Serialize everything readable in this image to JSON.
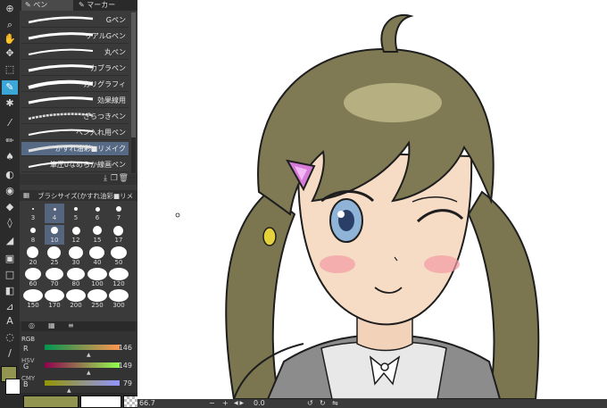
{
  "tabs": {
    "pen": "ペン",
    "marker": "マーカー"
  },
  "brushes": [
    {
      "label": "Gペン"
    },
    {
      "label": "リアルGペン"
    },
    {
      "label": "丸ペン"
    },
    {
      "label": "カブラペン"
    },
    {
      "label": "カリグラフィ"
    },
    {
      "label": "効果線用"
    },
    {
      "label": "ざらつきペン"
    },
    {
      "label": "ペン入れ用ペン"
    },
    {
      "label": "かすれ油彩■リメイク"
    },
    {
      "label": "筆圧0なめらか線画ペン"
    }
  ],
  "brush_size_title": "ブラシサイズ(かすれ油彩■リメ",
  "sizes": [
    "3",
    "4",
    "5",
    "6",
    "7",
    "8",
    "10",
    "12",
    "15",
    "17",
    "20",
    "25",
    "30",
    "40",
    "50",
    "60",
    "70",
    "80",
    "100",
    "120",
    "150",
    "170",
    "200",
    "250",
    "300"
  ],
  "color": {
    "mode_label": "RGB",
    "channels": [
      {
        "name": "R",
        "value": "146"
      },
      {
        "name": "G",
        "value": "149"
      },
      {
        "name": "B",
        "value": "79"
      }
    ],
    "main_color": "#92954f",
    "sub_color": "#ffffff"
  },
  "side_labels": [
    "HSV",
    "CMY"
  ],
  "zoom": "66.7",
  "bottom_value": "0.0"
}
